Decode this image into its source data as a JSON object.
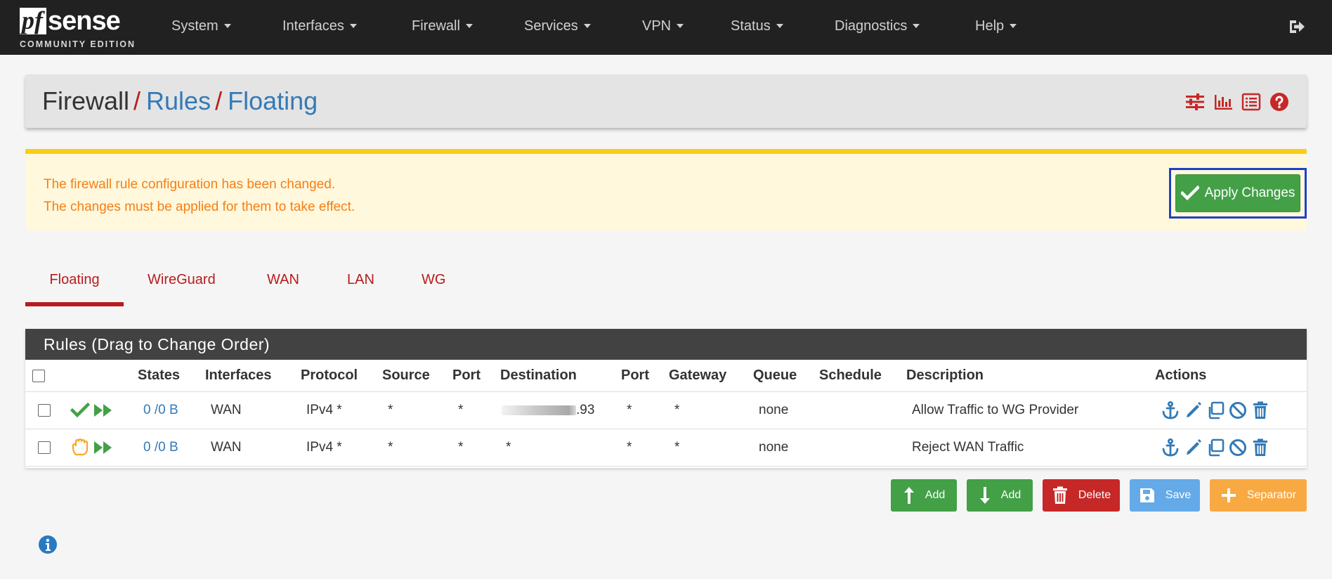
{
  "logo": {
    "main_pf": "pf",
    "main_sense": "sense",
    "sub": "COMMUNITY EDITION"
  },
  "nav": {
    "items": [
      {
        "label": "System"
      },
      {
        "label": "Interfaces"
      },
      {
        "label": "Firewall"
      },
      {
        "label": "Services"
      },
      {
        "label": "VPN"
      },
      {
        "label": "Status"
      },
      {
        "label": "Diagnostics"
      },
      {
        "label": "Help"
      }
    ],
    "logout_icon": "sign-out-icon"
  },
  "breadcrumb": {
    "root": "Firewall",
    "sep": "/",
    "level1": "Rules",
    "level2": "Floating"
  },
  "header_icons": [
    "sliders-icon",
    "bar-chart-icon",
    "list-icon",
    "question-circle-icon"
  ],
  "alert": {
    "line1": "The firewall rule configuration has been changed.",
    "line2": "The changes must be applied for them to take effect.",
    "apply_label": "Apply Changes"
  },
  "tabs": [
    {
      "label": "Floating",
      "active": true
    },
    {
      "label": "WireGuard"
    },
    {
      "label": "WAN"
    },
    {
      "label": "LAN"
    },
    {
      "label": "WG"
    }
  ],
  "rules": {
    "title": "Rules (Drag to Change Order)",
    "columns": [
      "States",
      "Interfaces",
      "Protocol",
      "Source",
      "Port",
      "Destination",
      "Port",
      "Gateway",
      "Queue",
      "Schedule",
      "Description",
      "Actions"
    ],
    "rows": [
      {
        "action": "pass",
        "states": "0 /0 B",
        "interface": "WAN",
        "protocol": "IPv4 *",
        "source": "*",
        "source_port": "*",
        "destination": ".93",
        "dest_port": "*",
        "gateway": "*",
        "queue": "none",
        "schedule": "",
        "description": "Allow Traffic to WG Provider"
      },
      {
        "action": "reject",
        "states": "0 /0 B",
        "interface": "WAN",
        "protocol": "IPv4 *",
        "source": "*",
        "source_port": "*",
        "destination": "*",
        "dest_port": "*",
        "gateway": "*",
        "queue": "none",
        "schedule": "",
        "description": "Reject WAN Traffic"
      }
    ]
  },
  "buttons": {
    "add_top": "Add",
    "add_bottom": "Add",
    "delete": "Delete",
    "save": "Save",
    "separator": "Separator"
  },
  "colors": {
    "accent_red": "#b71c1c",
    "link_blue": "#337ab7",
    "success_green": "#43a047",
    "alert_orange": "#f57f17"
  }
}
